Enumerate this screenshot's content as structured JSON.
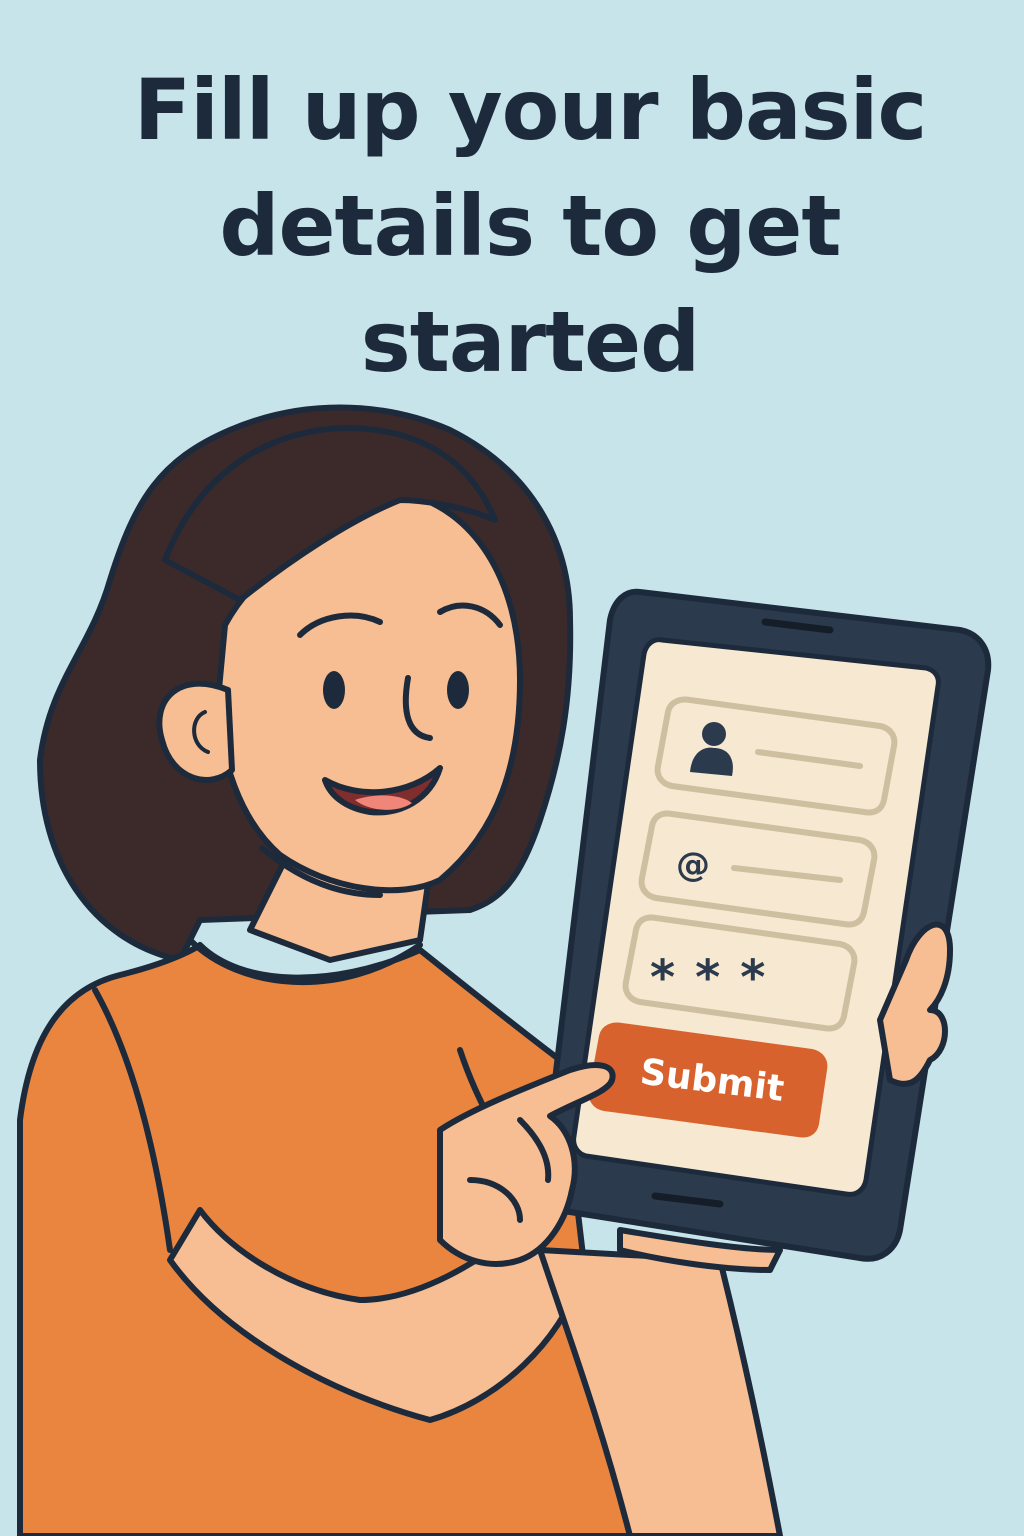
{
  "headline": "Fill up your basic details to get started",
  "form": {
    "password_mask": "***",
    "submit_label": "Submit",
    "field_icons": [
      "user-icon",
      "at-sign-icon",
      "asterisk-password-icon"
    ]
  },
  "colors": {
    "background": "#c6e4ea",
    "ink": "#1d2a3b",
    "skin": "#f7be93",
    "hair": "#3c2a2b",
    "shirt": "#e9853f",
    "phone_frame": "#2c3a4e",
    "screen": "#f6e8d1",
    "field_border": "#cdbf9f",
    "button": "#d8622d"
  }
}
